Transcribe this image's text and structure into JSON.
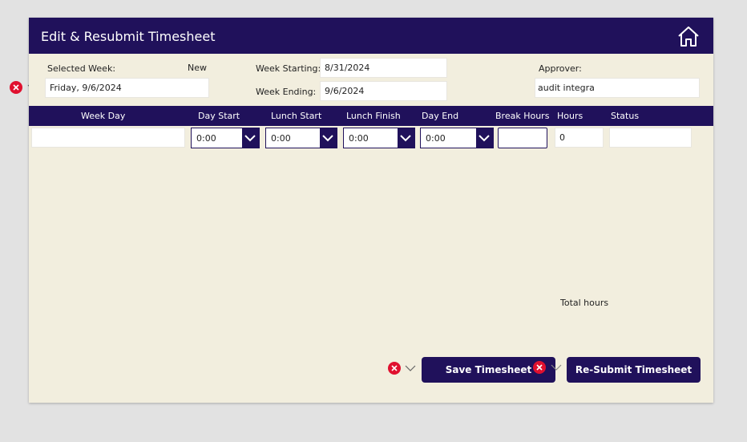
{
  "header": {
    "title": "Edit & Resubmit Timesheet",
    "home_icon": "home-icon"
  },
  "form": {
    "selected_week_label": "Selected Week:",
    "status_new": "New",
    "selected_week_value": "Friday, 9/6/2024",
    "week_starting_label": "Week Starting:",
    "week_starting_value": "8/31/2024",
    "week_ending_label": "Week Ending:",
    "week_ending_value": "9/6/2024",
    "approver_label": "Approver:",
    "approver_value": "audit integra"
  },
  "table": {
    "headers": [
      "Week Day",
      "Day Start",
      "Lunch Start",
      "Lunch Finish",
      "Day End",
      "Break Hours",
      "Hours",
      "Status"
    ],
    "row": {
      "week_day": "",
      "day_start": "0:00",
      "lunch_start": "0:00",
      "lunch_finish": "0:00",
      "day_end": "0:00",
      "break_hours": "",
      "hours": "0",
      "status": ""
    }
  },
  "footer": {
    "total_hours_label": "Total hours",
    "save_label": "Save Timesheet",
    "resubmit_label": "Re-Submit Timesheet"
  },
  "colors": {
    "primary": "#20115b",
    "background": "#f2eede",
    "error": "#e0102f"
  }
}
